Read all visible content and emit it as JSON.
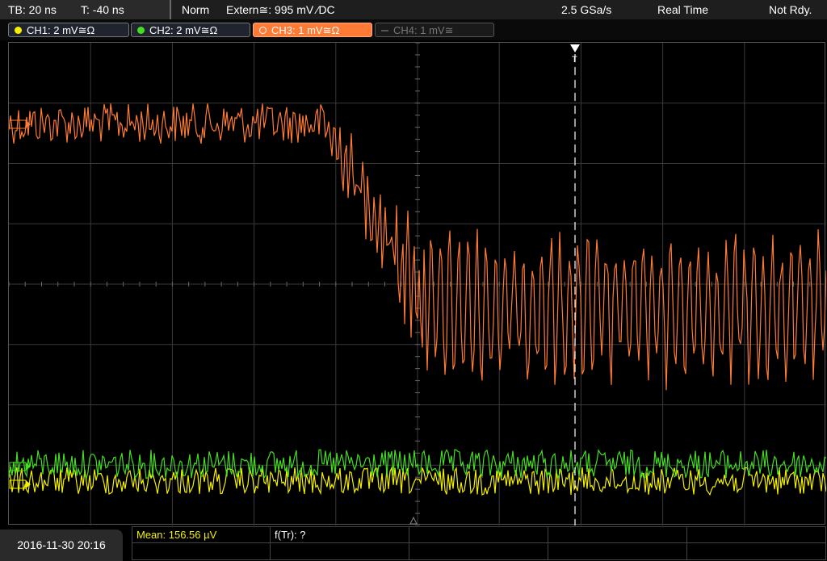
{
  "timebase": {
    "tb": "TB: 20 ns",
    "trigger_pos": "T: -40 ns"
  },
  "status": {
    "mode": "Norm",
    "trigger": "Extern≅: 995 mV ⁄DC",
    "sample_rate": "2.5 GSa/s",
    "acq": "Real Time",
    "state": "Not Rdy."
  },
  "channels": [
    {
      "label": "CH1: 2 mV≅Ω",
      "color": "#f5f000",
      "active": true
    },
    {
      "label": "CH2: 2 mV≅Ω",
      "color": "#44dd22",
      "active": true
    },
    {
      "label": "CH3: 1 mV≅Ω",
      "color": "#ff8a3c",
      "active": true,
      "selected": true
    },
    {
      "label": "CH4: 1 mV≅",
      "color": "#555555",
      "active": false
    }
  ],
  "trigger_marker": "T",
  "measurements": {
    "mean": "Mean: 156.56 µV",
    "ftr": "f(Tr): ?"
  },
  "datetime": "2016-11-30 20:16",
  "colors": {
    "ch1": "#f5f000",
    "ch2": "#44dd22",
    "ch3": "#ff7b35",
    "grid": "#3a3a3a"
  },
  "icons": [
    "trigger-arrow-icon",
    "ground-marker-icon",
    "center-marker-icon"
  ]
}
